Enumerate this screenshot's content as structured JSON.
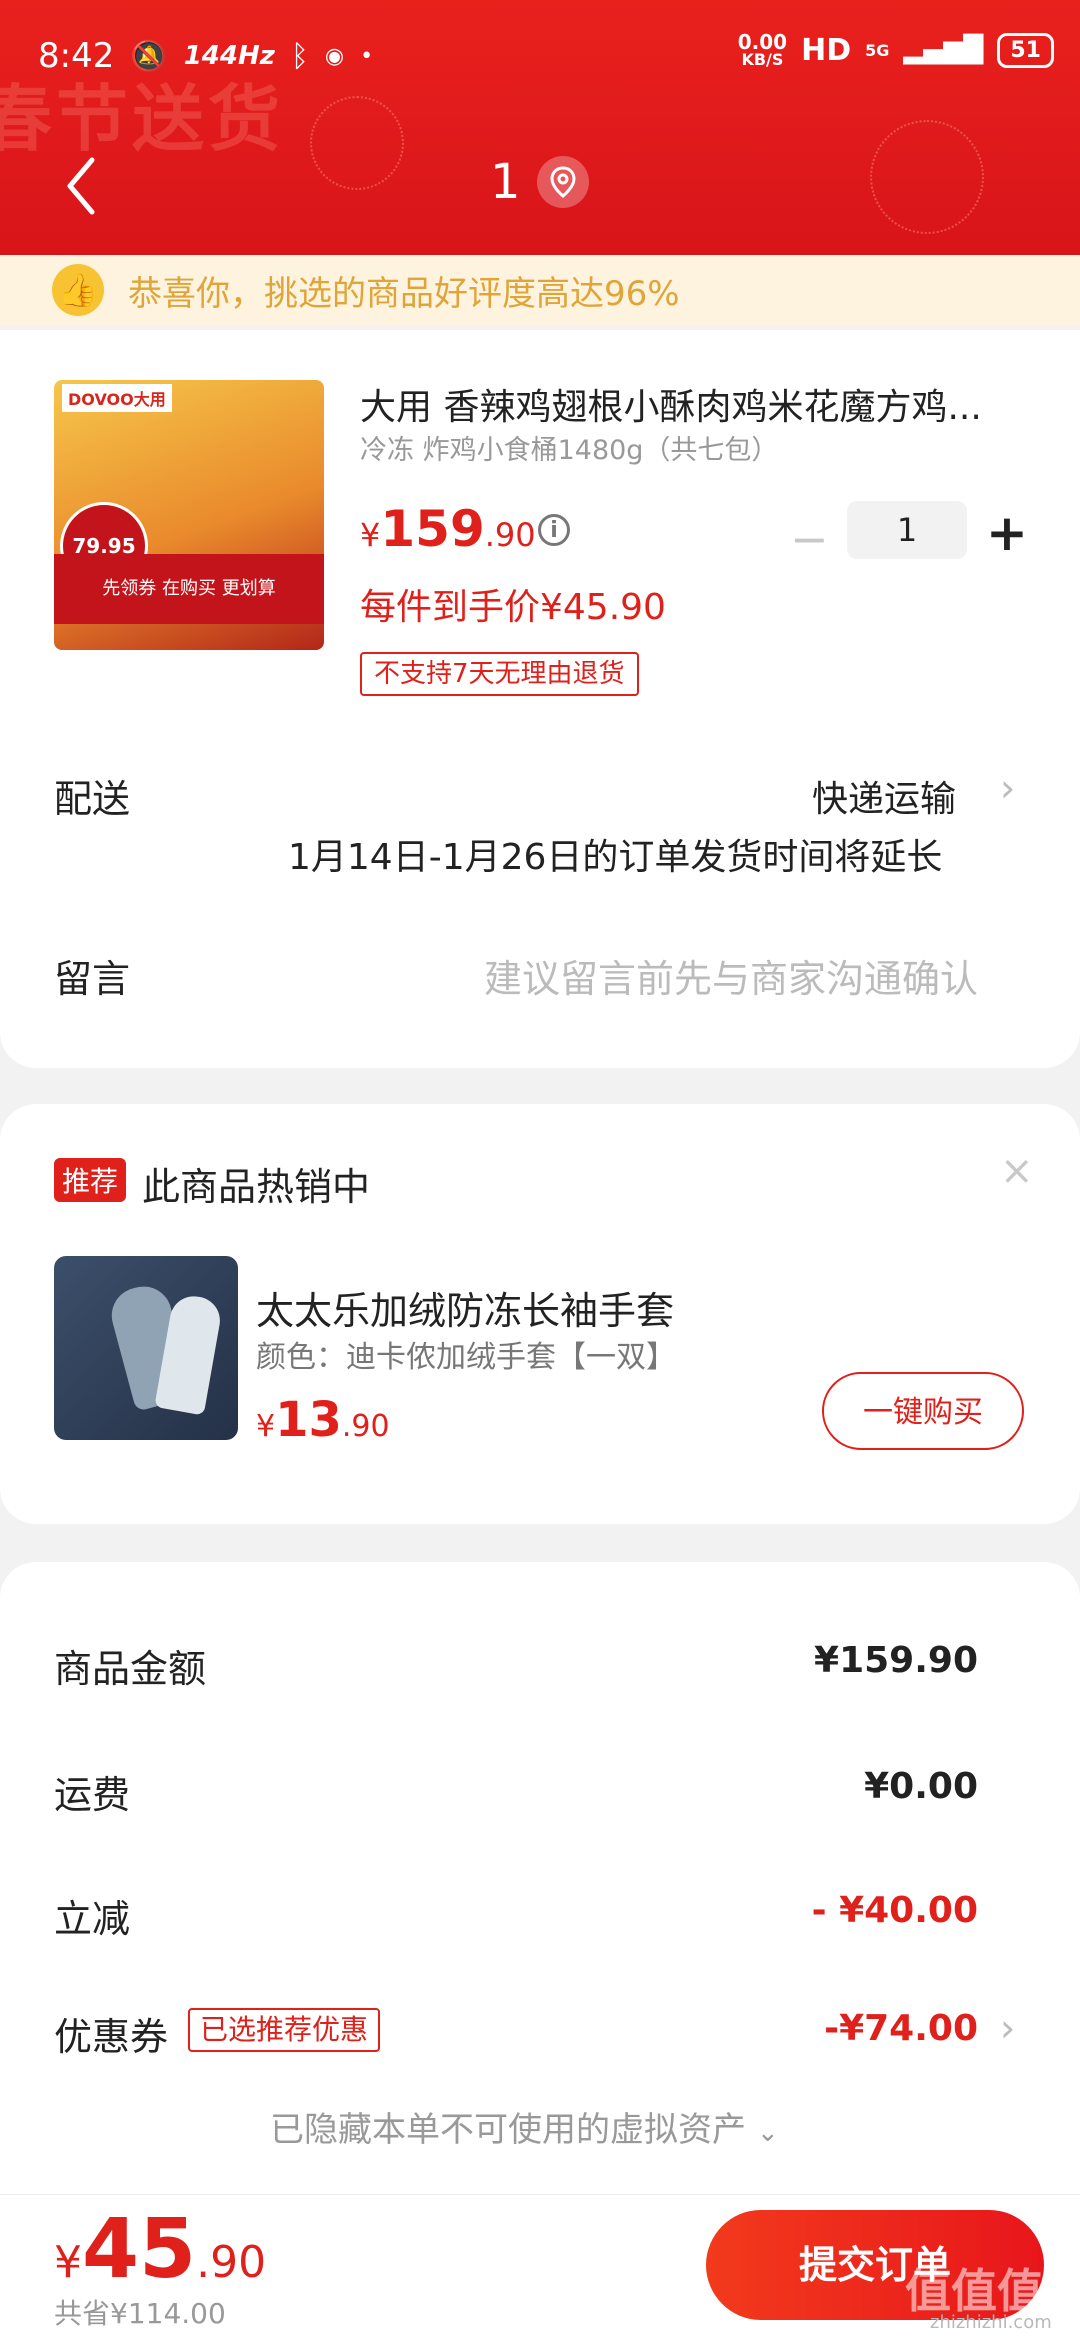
{
  "status_bar": {
    "time": "8:42",
    "refresh_rate": "144Hz",
    "net_speed_value": "0.00",
    "net_speed_unit": "KB/S",
    "hd": "HD",
    "network": "5G",
    "battery": "51"
  },
  "header": {
    "title": "1",
    "background_text": "春节送货"
  },
  "notice": {
    "text": "恭喜你，挑选的商品好评度高达96%"
  },
  "product": {
    "image_brand": "DOVOO大用",
    "image_promo": "先领券 在购买 更划算",
    "image_price": "79.95",
    "title": "大用 香辣鸡翅根小酥肉鸡米花魔方鸡...",
    "spec": "冷冻 炸鸡小食桶1480g（共七包）",
    "price_symbol": "¥",
    "price_int": "159",
    "price_dec": ".90",
    "quantity": "1",
    "final_price": "每件到手价¥45.90",
    "return_policy": "不支持7天无理由退货"
  },
  "delivery": {
    "label": "配送",
    "method": "快递运输",
    "notice": "1月14日-1月26日的订单发货时间将延长"
  },
  "message": {
    "label": "留言",
    "placeholder": "建议留言前先与商家沟通确认"
  },
  "recommend": {
    "badge": "推荐",
    "title": "此商品热销中",
    "close": "×",
    "item_name": "太太乐加绒防冻长袖手套",
    "item_color": "颜色：迪卡侬加绒手套【一双】",
    "price_symbol": "¥",
    "price_int": "13",
    "price_dec": ".90",
    "buy_label": "一键购买"
  },
  "summary": {
    "goods_label": "商品金额",
    "goods_value": "¥159.90",
    "shipping_label": "运费",
    "shipping_value": "¥0.00",
    "discount_label": "立减",
    "discount_value": "- ¥40.00",
    "coupon_label": "优惠券",
    "coupon_tag": "已选推荐优惠",
    "coupon_value": "-¥74.00",
    "hidden_assets": "已隐藏本单不可使用的虚拟资产"
  },
  "bottom": {
    "total_symbol": "¥",
    "total_int": "45",
    "total_dec": ".90",
    "saved": "共省¥114.00",
    "submit": "提交订单",
    "watermark": "值值值",
    "watermark_url": "zhizhizhi.com"
  },
  "colors": {
    "accent_red": "#e0201a",
    "header_red": "#e9211d",
    "notice_bg": "#fdf3df",
    "notice_text": "#e0a538"
  }
}
